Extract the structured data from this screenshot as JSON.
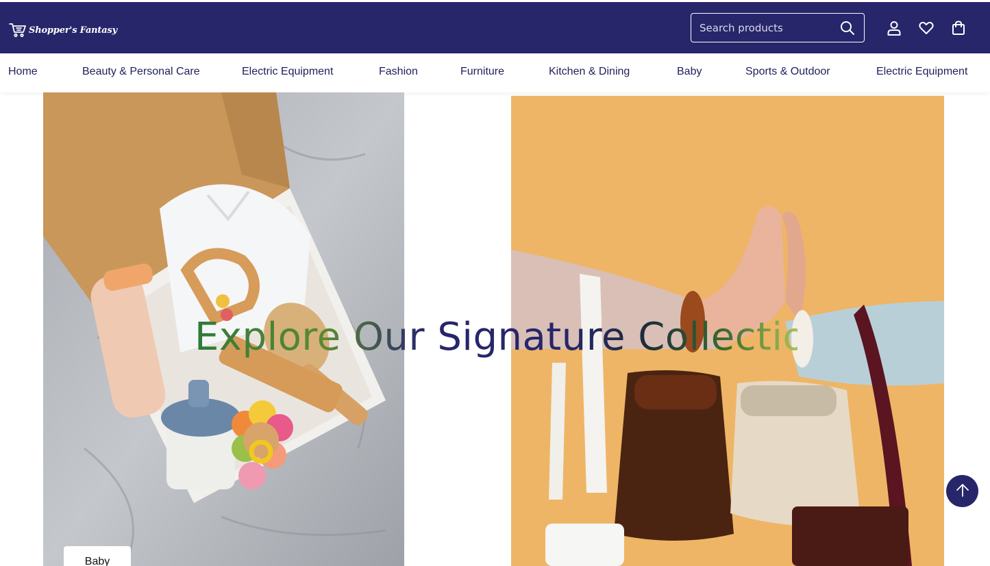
{
  "header": {
    "logo_text": "Shopper's Fantasy",
    "search": {
      "placeholder": "Search products",
      "value": ""
    },
    "icons": [
      "search-icon",
      "user-icon",
      "heart-icon",
      "shopping-bag-icon"
    ]
  },
  "nav": {
    "items": [
      {
        "label": "Home"
      },
      {
        "label": "Beauty & Personal Care"
      },
      {
        "label": "Electric Equipment"
      },
      {
        "label": "Fashion"
      },
      {
        "label": "Furniture"
      },
      {
        "label": "Kitchen & Dining"
      },
      {
        "label": "Baby"
      },
      {
        "label": "Sports & Outdoor"
      },
      {
        "label": "Electric Equipment"
      }
    ]
  },
  "hero": {
    "headline": "Explore Our Signature Collections",
    "cards": [
      {
        "label": "Baby"
      },
      {
        "label": ""
      }
    ]
  },
  "colors": {
    "brand": "#27266b",
    "nav_text": "#1f1f5c",
    "fashion_bg": "#eeb566",
    "baby_bg": "#b9bcc1"
  },
  "scroll_top": {
    "icon": "arrow-up-icon"
  }
}
